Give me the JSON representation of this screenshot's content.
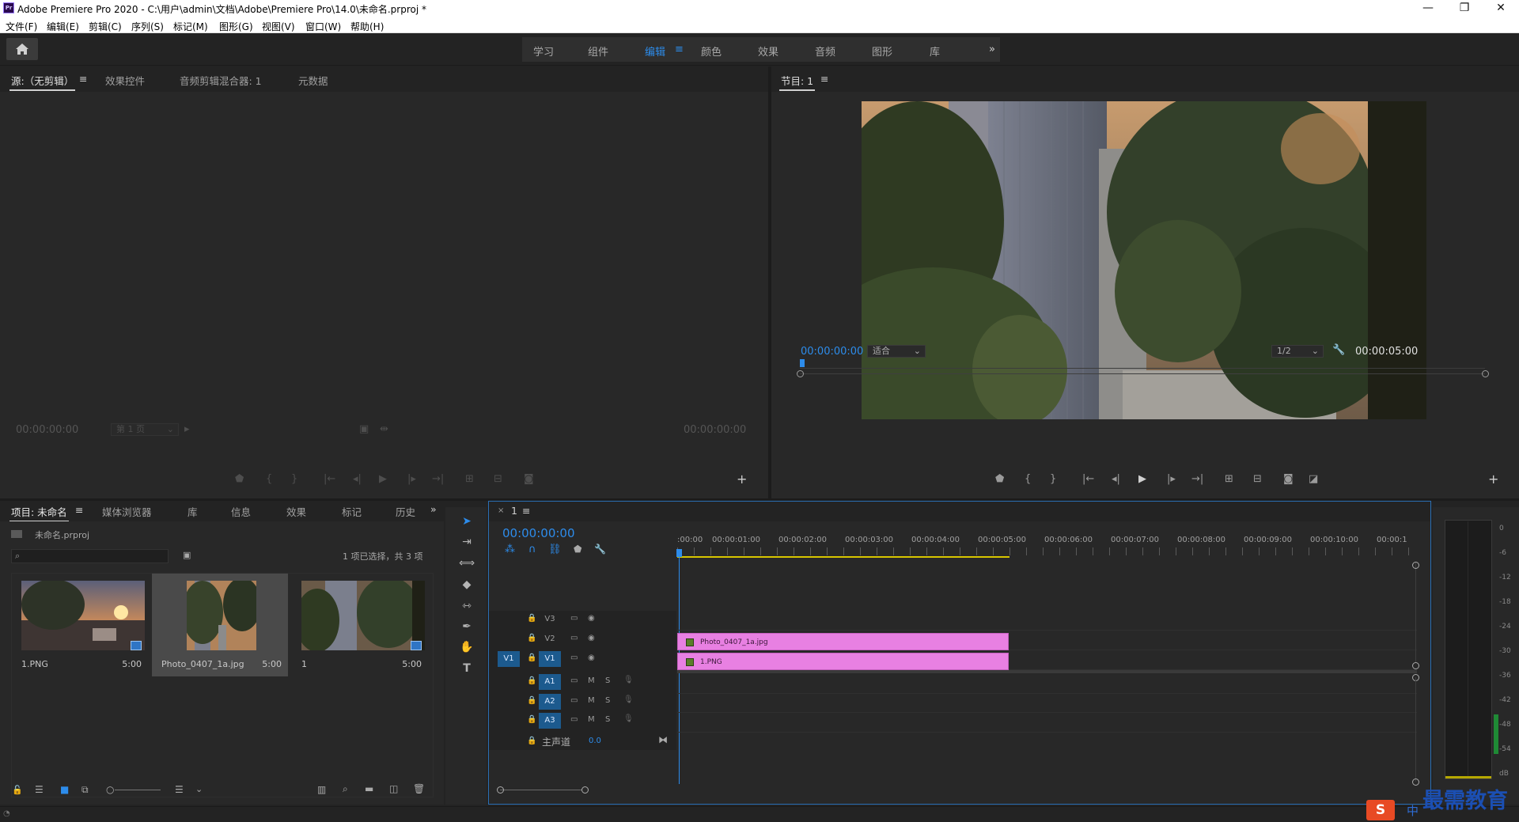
{
  "window": {
    "title": "Adobe Premiere Pro 2020 - C:\\用户\\admin\\文档\\Adobe\\Premiere Pro\\14.0\\未命名.prproj *",
    "app_icon": "Pr",
    "controls": [
      "—",
      "❐",
      "✕"
    ]
  },
  "menu": [
    "文件(F)",
    "编辑(E)",
    "剪辑(C)",
    "序列(S)",
    "标记(M)",
    "图形(G)",
    "视图(V)",
    "窗口(W)",
    "帮助(H)"
  ],
  "workspaces": {
    "tabs": [
      "学习",
      "组件",
      "编辑",
      "颜色",
      "效果",
      "音频",
      "图形",
      "库"
    ],
    "active": "编辑",
    "more": "»"
  },
  "source_panel": {
    "tabs": [
      "源:（无剪辑）",
      "效果控件",
      "音频剪辑混合器: 1",
      "元数据"
    ],
    "menu_icon": "≡",
    "timecode_left": "00:00:00:00",
    "timecode_right": "00:00:00:00",
    "page_select": "第 1 页"
  },
  "program_panel": {
    "tab": "节目: 1",
    "menu_icon": "≡",
    "timecode_current": "00:00:00:00",
    "fit": "适合",
    "resolution": "1/2",
    "timecode_duration": "00:00:05:00"
  },
  "project_panel": {
    "tabs": [
      "项目: 未命名",
      "媒体浏览器",
      "库",
      "信息",
      "效果",
      "标记",
      "历史"
    ],
    "more": "»",
    "menu_icon": "≡",
    "file": "未命名.prproj",
    "search_placeholder": "",
    "selection_info": "1 项已选择，共 3 项",
    "items": [
      {
        "name": "1.PNG",
        "duration": "5:00"
      },
      {
        "name": "Photo_0407_1a.jpg",
        "duration": "5:00"
      },
      {
        "name": "1",
        "duration": "5:00"
      }
    ]
  },
  "timeline": {
    "tab": "1",
    "close": "×",
    "menu_icon": "≡",
    "timecode": "00:00:00:00",
    "ruler": [
      ":00:00",
      "00:00:01:00",
      "00:00:02:00",
      "00:00:03:00",
      "00:00:04:00",
      "00:00:05:00",
      "00:00:06:00",
      "00:00:07:00",
      "00:00:08:00",
      "00:00:09:00",
      "00:00:10:00",
      "00:00:1"
    ],
    "video_tracks": [
      "V3",
      "V2",
      "V1"
    ],
    "audio_tracks": [
      "A1",
      "A2",
      "A3"
    ],
    "source_patch": "V1",
    "mute": "M",
    "solo": "S",
    "master": {
      "label": "主声道",
      "value": "0.0"
    },
    "clips": [
      {
        "name": "Photo_0407_1a.jpg",
        "track": "V2"
      },
      {
        "name": "1.PNG",
        "track": "V1"
      }
    ]
  },
  "audio_meter": {
    "labels": [
      "0",
      "-6",
      "-12",
      "-18",
      "-24",
      "-30",
      "-36",
      "-42",
      "-48",
      "-54",
      "dB"
    ]
  },
  "tools": [
    "selection-tool",
    "track-select-tool",
    "ripple-edit-tool",
    "razor-tool",
    "slip-tool",
    "pen-tool",
    "hand-tool",
    "type-tool"
  ],
  "watermark": "最需教育",
  "ime": "中"
}
